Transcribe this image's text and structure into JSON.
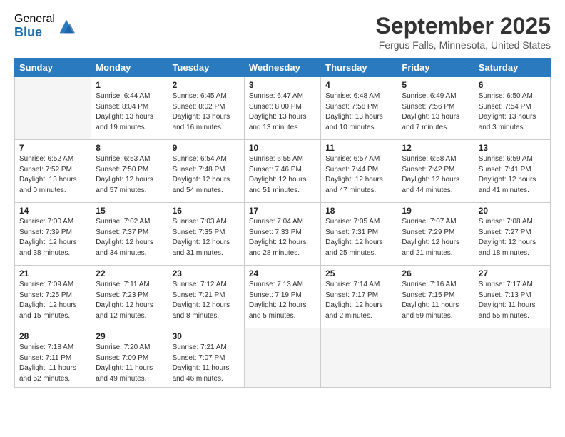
{
  "logo": {
    "general": "General",
    "blue": "Blue"
  },
  "title": "September 2025",
  "location": "Fergus Falls, Minnesota, United States",
  "days_of_week": [
    "Sunday",
    "Monday",
    "Tuesday",
    "Wednesday",
    "Thursday",
    "Friday",
    "Saturday"
  ],
  "weeks": [
    [
      {
        "day": "",
        "info": ""
      },
      {
        "day": "1",
        "info": "Sunrise: 6:44 AM\nSunset: 8:04 PM\nDaylight: 13 hours\nand 19 minutes."
      },
      {
        "day": "2",
        "info": "Sunrise: 6:45 AM\nSunset: 8:02 PM\nDaylight: 13 hours\nand 16 minutes."
      },
      {
        "day": "3",
        "info": "Sunrise: 6:47 AM\nSunset: 8:00 PM\nDaylight: 13 hours\nand 13 minutes."
      },
      {
        "day": "4",
        "info": "Sunrise: 6:48 AM\nSunset: 7:58 PM\nDaylight: 13 hours\nand 10 minutes."
      },
      {
        "day": "5",
        "info": "Sunrise: 6:49 AM\nSunset: 7:56 PM\nDaylight: 13 hours\nand 7 minutes."
      },
      {
        "day": "6",
        "info": "Sunrise: 6:50 AM\nSunset: 7:54 PM\nDaylight: 13 hours\nand 3 minutes."
      }
    ],
    [
      {
        "day": "7",
        "info": "Sunrise: 6:52 AM\nSunset: 7:52 PM\nDaylight: 13 hours\nand 0 minutes."
      },
      {
        "day": "8",
        "info": "Sunrise: 6:53 AM\nSunset: 7:50 PM\nDaylight: 12 hours\nand 57 minutes."
      },
      {
        "day": "9",
        "info": "Sunrise: 6:54 AM\nSunset: 7:48 PM\nDaylight: 12 hours\nand 54 minutes."
      },
      {
        "day": "10",
        "info": "Sunrise: 6:55 AM\nSunset: 7:46 PM\nDaylight: 12 hours\nand 51 minutes."
      },
      {
        "day": "11",
        "info": "Sunrise: 6:57 AM\nSunset: 7:44 PM\nDaylight: 12 hours\nand 47 minutes."
      },
      {
        "day": "12",
        "info": "Sunrise: 6:58 AM\nSunset: 7:42 PM\nDaylight: 12 hours\nand 44 minutes."
      },
      {
        "day": "13",
        "info": "Sunrise: 6:59 AM\nSunset: 7:41 PM\nDaylight: 12 hours\nand 41 minutes."
      }
    ],
    [
      {
        "day": "14",
        "info": "Sunrise: 7:00 AM\nSunset: 7:39 PM\nDaylight: 12 hours\nand 38 minutes."
      },
      {
        "day": "15",
        "info": "Sunrise: 7:02 AM\nSunset: 7:37 PM\nDaylight: 12 hours\nand 34 minutes."
      },
      {
        "day": "16",
        "info": "Sunrise: 7:03 AM\nSunset: 7:35 PM\nDaylight: 12 hours\nand 31 minutes."
      },
      {
        "day": "17",
        "info": "Sunrise: 7:04 AM\nSunset: 7:33 PM\nDaylight: 12 hours\nand 28 minutes."
      },
      {
        "day": "18",
        "info": "Sunrise: 7:05 AM\nSunset: 7:31 PM\nDaylight: 12 hours\nand 25 minutes."
      },
      {
        "day": "19",
        "info": "Sunrise: 7:07 AM\nSunset: 7:29 PM\nDaylight: 12 hours\nand 21 minutes."
      },
      {
        "day": "20",
        "info": "Sunrise: 7:08 AM\nSunset: 7:27 PM\nDaylight: 12 hours\nand 18 minutes."
      }
    ],
    [
      {
        "day": "21",
        "info": "Sunrise: 7:09 AM\nSunset: 7:25 PM\nDaylight: 12 hours\nand 15 minutes."
      },
      {
        "day": "22",
        "info": "Sunrise: 7:11 AM\nSunset: 7:23 PM\nDaylight: 12 hours\nand 12 minutes."
      },
      {
        "day": "23",
        "info": "Sunrise: 7:12 AM\nSunset: 7:21 PM\nDaylight: 12 hours\nand 8 minutes."
      },
      {
        "day": "24",
        "info": "Sunrise: 7:13 AM\nSunset: 7:19 PM\nDaylight: 12 hours\nand 5 minutes."
      },
      {
        "day": "25",
        "info": "Sunrise: 7:14 AM\nSunset: 7:17 PM\nDaylight: 12 hours\nand 2 minutes."
      },
      {
        "day": "26",
        "info": "Sunrise: 7:16 AM\nSunset: 7:15 PM\nDaylight: 11 hours\nand 59 minutes."
      },
      {
        "day": "27",
        "info": "Sunrise: 7:17 AM\nSunset: 7:13 PM\nDaylight: 11 hours\nand 55 minutes."
      }
    ],
    [
      {
        "day": "28",
        "info": "Sunrise: 7:18 AM\nSunset: 7:11 PM\nDaylight: 11 hours\nand 52 minutes."
      },
      {
        "day": "29",
        "info": "Sunrise: 7:20 AM\nSunset: 7:09 PM\nDaylight: 11 hours\nand 49 minutes."
      },
      {
        "day": "30",
        "info": "Sunrise: 7:21 AM\nSunset: 7:07 PM\nDaylight: 11 hours\nand 46 minutes."
      },
      {
        "day": "",
        "info": ""
      },
      {
        "day": "",
        "info": ""
      },
      {
        "day": "",
        "info": ""
      },
      {
        "day": "",
        "info": ""
      }
    ]
  ]
}
